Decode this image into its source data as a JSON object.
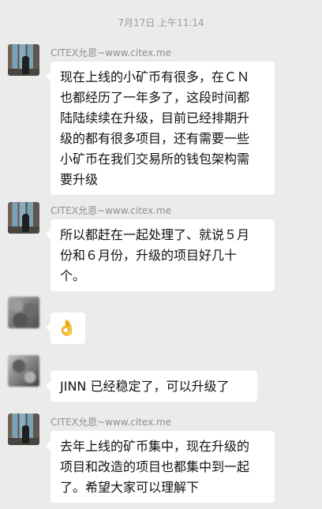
{
  "chat": {
    "timestamp": "7月17日 上午11:14",
    "messages": [
      {
        "sender": "CITEX允恩~www.citex.me",
        "avatar_icon": "person-by-window-avatar",
        "lines": [
          "现在上线的小矿币有很多，在ＣＮ",
          "也都经历了一年多了，这段时间都",
          "陆陆续续在升级，目前已经排期升",
          "级的都有很多项目，还有需要一些",
          "小矿币在我们交易所的钱包架构需",
          "要升级"
        ]
      },
      {
        "sender": "CITEX允恩~www.citex.me",
        "avatar_icon": "person-by-window-avatar",
        "lines": [
          "所以都赶在一起处理了、就说５月",
          "份和６月份，升级的项目好几十",
          "个。"
        ]
      },
      {
        "sender": "",
        "avatar_icon": "blurred-avatar",
        "lines": [
          "👌"
        ]
      },
      {
        "sender": "",
        "avatar_icon": "blurred-avatar",
        "lines": [
          "JINN 已经稳定了，可以升级了"
        ]
      },
      {
        "sender": "CITEX允恩~www.citex.me",
        "avatar_icon": "person-by-window-avatar",
        "lines": [
          "去年上线的矿币集中，现在升级的",
          "项目和改造的项目也都集中到一起",
          "了。希望大家可以理解下"
        ]
      }
    ]
  }
}
